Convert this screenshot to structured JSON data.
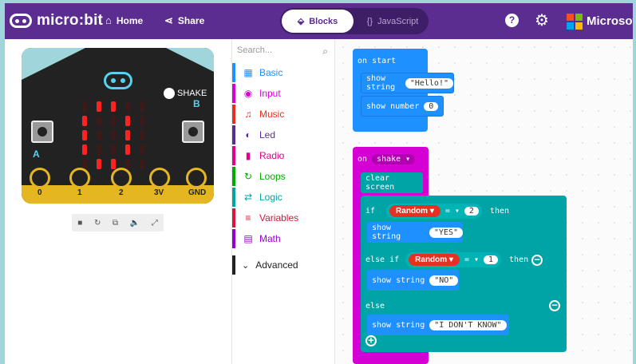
{
  "header": {
    "logo_text": "micro:bit",
    "home_label": "Home",
    "share_label": "Share",
    "blocks_label": "Blocks",
    "javascript_label": "JavaScript",
    "help_glyph": "?",
    "brand_label": "Microsoft"
  },
  "simulator": {
    "shake_label": "SHAKE",
    "button_a": "A",
    "button_b": "B",
    "pins": [
      "0",
      "1",
      "2",
      "3V",
      "GND"
    ],
    "controls": [
      "■",
      "↻",
      "⧉",
      "🔈",
      "⤢"
    ]
  },
  "toolbox": {
    "search_placeholder": "Search...",
    "categories": [
      {
        "label": "Basic",
        "color": "#1e90ff",
        "icon": "grid-icon",
        "glyph": "▦"
      },
      {
        "label": "Input",
        "color": "#d400d4",
        "icon": "target-icon",
        "glyph": "◉"
      },
      {
        "label": "Music",
        "color": "#e63022",
        "icon": "headphones-icon",
        "glyph": "♫"
      },
      {
        "label": "Led",
        "color": "#5c2d91",
        "icon": "toggle-icon",
        "glyph": "◐"
      },
      {
        "label": "Radio",
        "color": "#e3008c",
        "icon": "signal-icon",
        "glyph": "▮"
      },
      {
        "label": "Loops",
        "color": "#00aa00",
        "icon": "loop-icon",
        "glyph": "↻"
      },
      {
        "label": "Logic",
        "color": "#00a4a6",
        "icon": "shuffle-icon",
        "glyph": "⇄"
      },
      {
        "label": "Variables",
        "color": "#dc143c",
        "icon": "list-icon",
        "glyph": "≡"
      },
      {
        "label": "Math",
        "color": "#9400d3",
        "icon": "calculator-icon",
        "glyph": "▤"
      }
    ],
    "advanced_label": "Advanced"
  },
  "workspace": {
    "on_start": {
      "label": "on start",
      "show_string_label": "show string",
      "string_value": "\"Hello!\"",
      "show_number_label": "show number",
      "number_value": "0"
    },
    "on_shake": {
      "label": "on",
      "gesture": "shake ▾",
      "clear_screen": "clear screen",
      "if_label": "if",
      "random_label": "Random ▾",
      "op_label": "= ▾",
      "if_value": "2",
      "then_label": "then",
      "show_yes_label": "show string",
      "yes_value": "\"YES\"",
      "else_if_label": "else if",
      "else_if_random": "Random ▾",
      "else_if_op": "= ▾",
      "else_if_value": "1",
      "else_if_then": "then",
      "show_no_label": "show string",
      "no_value": "\"NO\"",
      "else_label": "else",
      "show_idk_label": "show string",
      "idk_value": "\"I DON'T KNOW\""
    }
  },
  "colors": {
    "header": "#5c2d91",
    "basic_block": "#1e90ff",
    "input_block": "#d400d4",
    "logic_block": "#00a4a6",
    "random_block": "#e63022"
  }
}
